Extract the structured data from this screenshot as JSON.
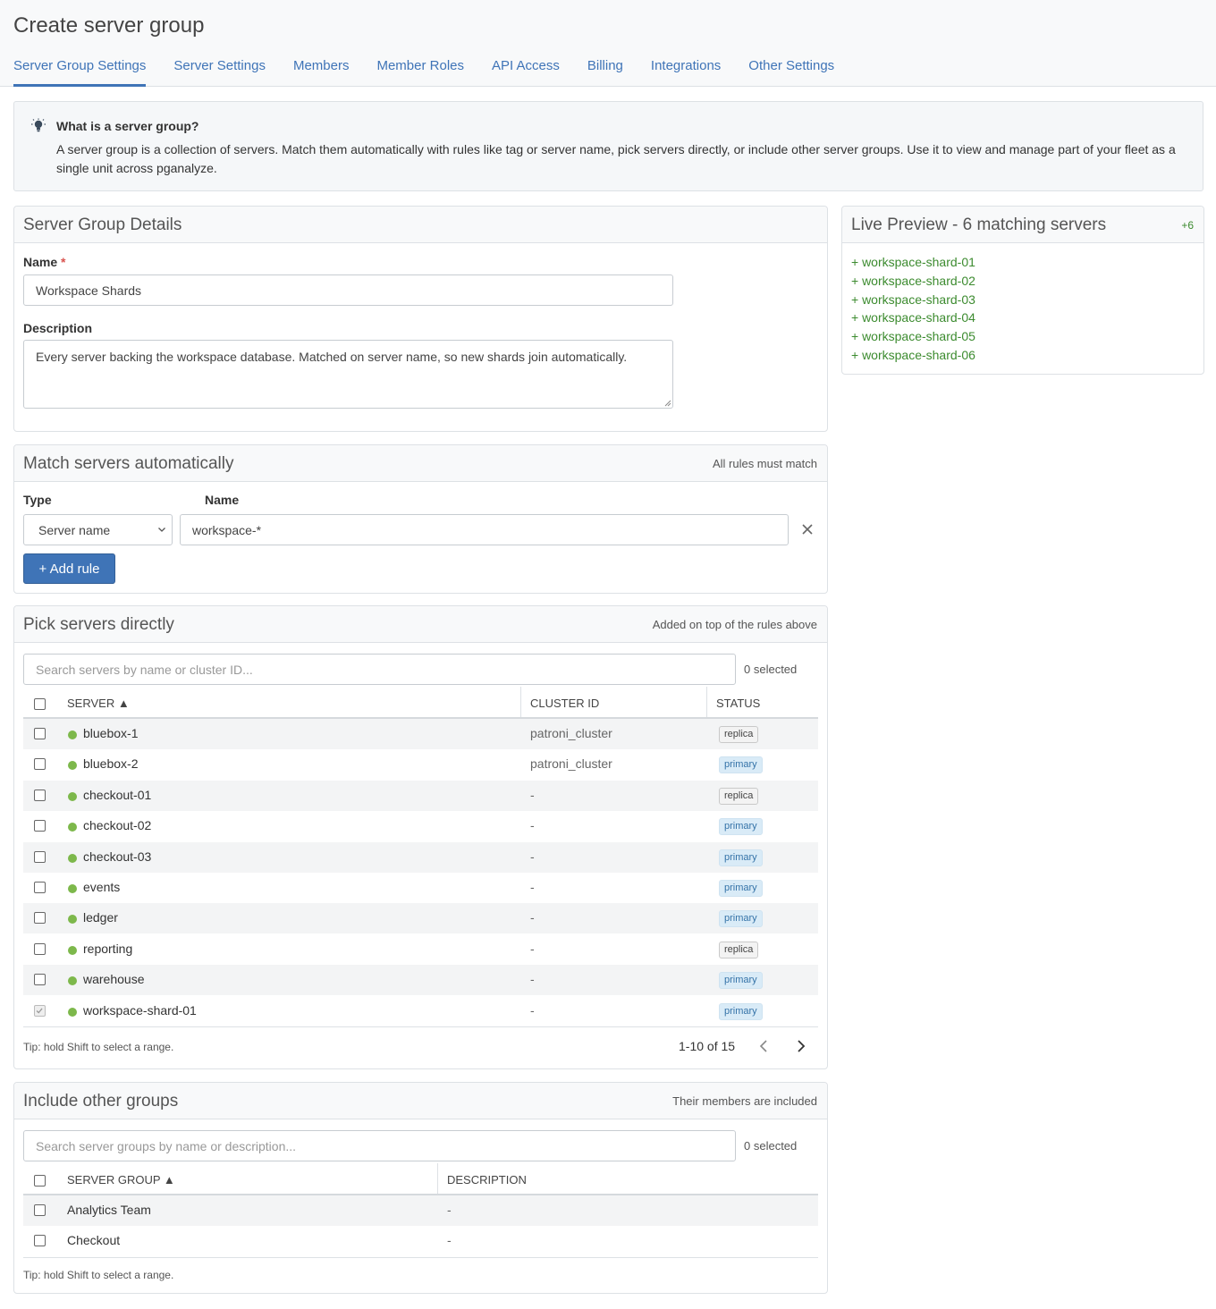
{
  "page": {
    "title": "Create server group"
  },
  "tabs": [
    {
      "label": "Server Group Settings",
      "active": true
    },
    {
      "label": "Server Settings"
    },
    {
      "label": "Members"
    },
    {
      "label": "Member Roles"
    },
    {
      "label": "API Access"
    },
    {
      "label": "Billing"
    },
    {
      "label": "Integrations"
    },
    {
      "label": "Other Settings"
    }
  ],
  "info": {
    "icon": "lightbulb-icon",
    "title": "What is a server group?",
    "text": "A server group is a collection of servers. Match them automatically with rules like tag or server name, pick servers directly, or include other server groups. Use it to view and manage part of your fleet as a single unit across pganalyze."
  },
  "details": {
    "title": "Server Group Details",
    "name_label": "Name",
    "required_mark": "*",
    "name_value": "Workspace Shards",
    "description_label": "Description",
    "description_value": "Every server backing the workspace database. Matched on server name, so new shards join automatically."
  },
  "preview": {
    "title": "Live Preview - 6 matching servers",
    "delta": "+6",
    "items": [
      "+ workspace-shard-01",
      "+ workspace-shard-02",
      "+ workspace-shard-03",
      "+ workspace-shard-04",
      "+ workspace-shard-05",
      "+ workspace-shard-06"
    ]
  },
  "rules": {
    "title": "Match servers automatically",
    "note": "All rules must match",
    "type_label": "Type",
    "name_label": "Name",
    "type_value": "Server name",
    "name_value": "workspace-*",
    "add_button": "+ Add rule"
  },
  "pick": {
    "title": "Pick servers directly",
    "note": "Added on top of the rules above",
    "search_placeholder": "Search servers by name or cluster ID...",
    "selected": "0 selected",
    "columns": {
      "server": "SERVER ▲",
      "cluster": "CLUSTER ID",
      "status": "STATUS"
    },
    "rows": [
      {
        "server": "bluebox-1",
        "cluster": "patroni_cluster",
        "status": "replica"
      },
      {
        "server": "bluebox-2",
        "cluster": "patroni_cluster",
        "status": "primary"
      },
      {
        "server": "checkout-01",
        "cluster": "-",
        "status": "replica"
      },
      {
        "server": "checkout-02",
        "cluster": "-",
        "status": "primary"
      },
      {
        "server": "checkout-03",
        "cluster": "-",
        "status": "primary"
      },
      {
        "server": "events",
        "cluster": "-",
        "status": "primary"
      },
      {
        "server": "ledger",
        "cluster": "-",
        "status": "primary"
      },
      {
        "server": "reporting",
        "cluster": "-",
        "status": "replica"
      },
      {
        "server": "warehouse",
        "cluster": "-",
        "status": "primary"
      },
      {
        "server": "workspace-shard-01",
        "cluster": "-",
        "status": "primary",
        "checked_disabled": true
      }
    ],
    "tip": "Tip: hold Shift to select a range.",
    "pagination": "1-10 of 15"
  },
  "groups": {
    "title": "Include other groups",
    "note": "Their members are included",
    "search_placeholder": "Search server groups by name or description...",
    "selected": "0 selected",
    "columns": {
      "group": "SERVER GROUP ▲",
      "description": "DESCRIPTION"
    },
    "rows": [
      {
        "group": "Analytics Team",
        "description": "-"
      },
      {
        "group": "Checkout",
        "description": "-"
      }
    ],
    "tip": "Tip: hold Shift to select a range."
  },
  "colors": {
    "accent": "#3f74b7",
    "success": "#3c8b2f",
    "online_dot": "#7db84b"
  }
}
